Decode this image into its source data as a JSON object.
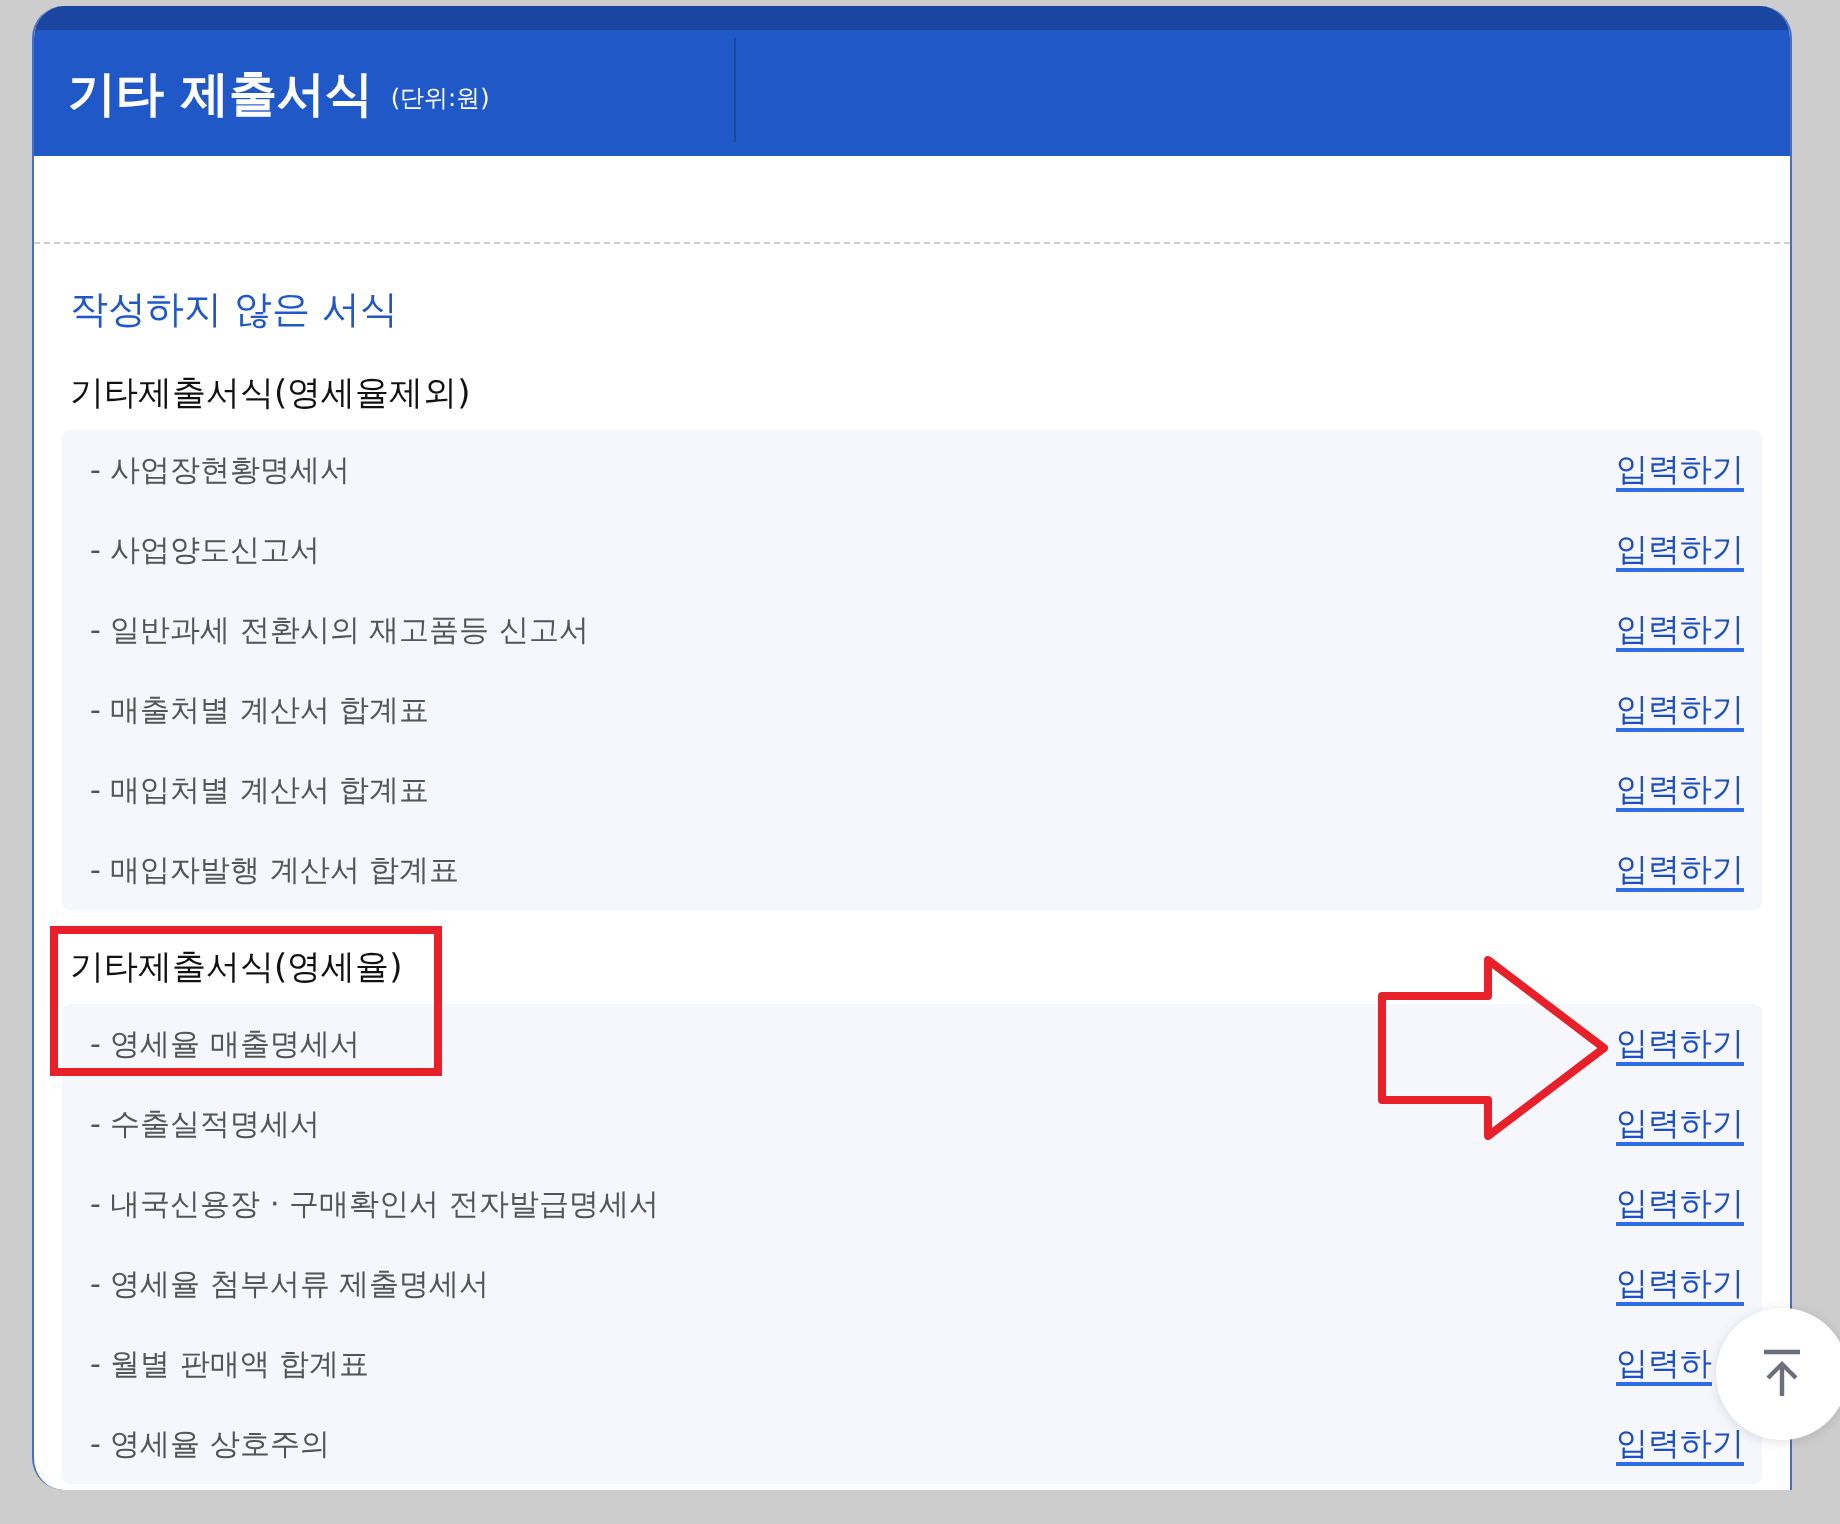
{
  "header": {
    "title": "기타 제출서식",
    "unit": "(단위:원)"
  },
  "section_title": "작성하지 않은 서식",
  "groups": [
    {
      "title": "기타제출서식(영세율제외)",
      "highlighted": false,
      "items": [
        {
          "name": "- 사업장현황명세서",
          "link": "입력하기"
        },
        {
          "name": "- 사업양도신고서",
          "link": "입력하기"
        },
        {
          "name": "- 일반과세 전환시의 재고품등 신고서",
          "link": "입력하기"
        },
        {
          "name": "- 매출처별 계산서 합계표",
          "link": "입력하기"
        },
        {
          "name": "- 매입처별 계산서 합계표",
          "link": "입력하기"
        },
        {
          "name": "- 매입자발행 계산서 합계표",
          "link": "입력하기"
        }
      ]
    },
    {
      "title": "기타제출서식(영세율)",
      "highlighted": true,
      "items": [
        {
          "name": "- 영세율 매출명세서",
          "link": "입력하기"
        },
        {
          "name": "- 수출실적명세서",
          "link": "입력하기"
        },
        {
          "name": "- 내국신용장 · 구매확인서 전자발급명세서",
          "link": "입력하기"
        },
        {
          "name": "- 영세율 첨부서류 제출명세서",
          "link": "입력하기"
        },
        {
          "name": "- 월별 판매액 합계표",
          "link": "입력하"
        },
        {
          "name": "- 영세율 상호주의",
          "link": "입력하기"
        }
      ]
    }
  ]
}
